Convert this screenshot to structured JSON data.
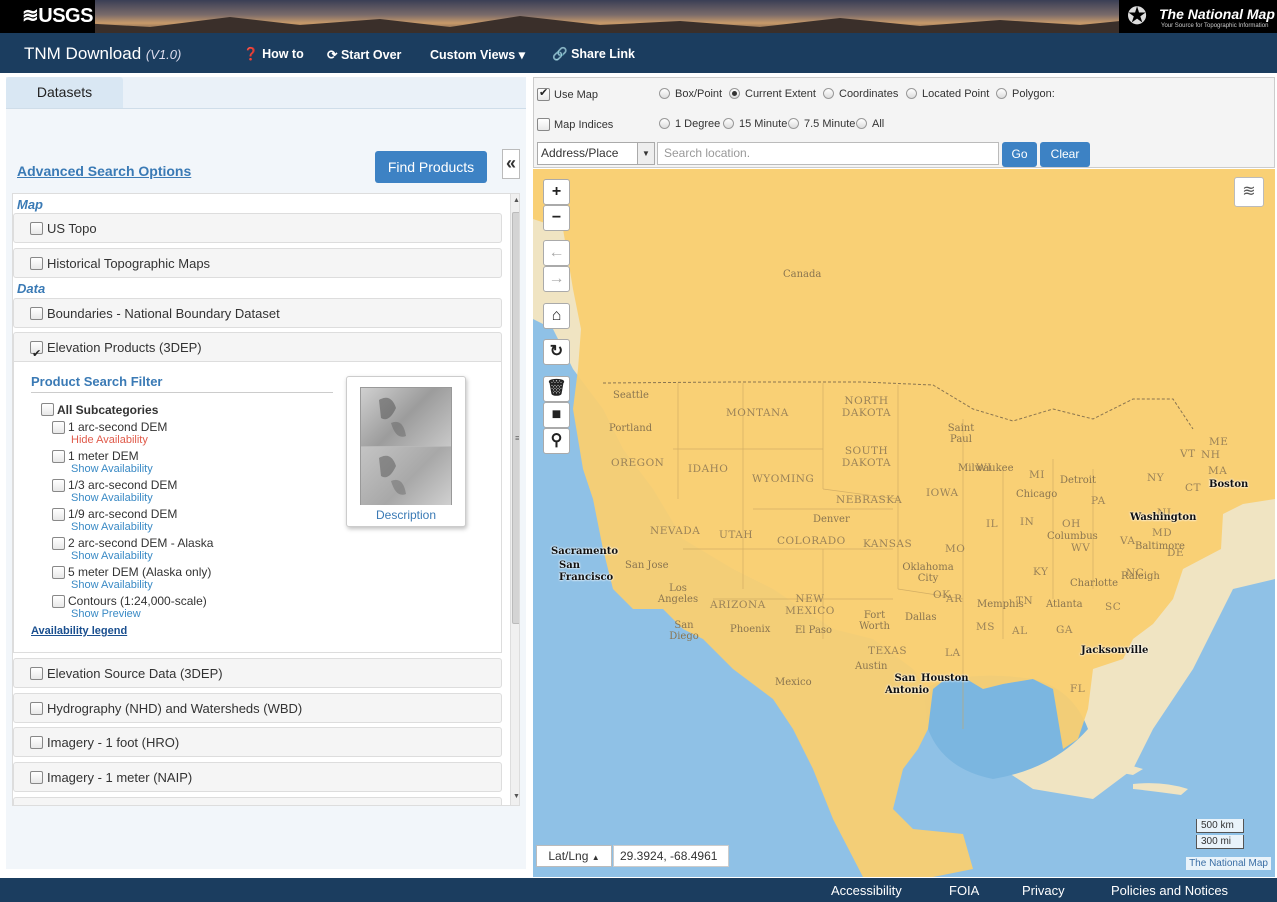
{
  "header": {
    "usgs_logo": "≋USGS",
    "tnm_logo_title": "The National Map",
    "tnm_logo_subtitle": "Your Source for Topographic Information"
  },
  "nav": {
    "app_title": "TNM Download",
    "version": "(V1.0)",
    "how_to": "How to",
    "start_over": "Start Over",
    "custom_views": "Custom Views",
    "share_link": "Share Link"
  },
  "left": {
    "tab": "Datasets",
    "advanced_search": "Advanced Search Options",
    "find_products": "Find Products",
    "collapse": "«",
    "section_map": "Map",
    "section_data": "Data",
    "items": {
      "us_topo": "US Topo",
      "historical": "Historical Topographic Maps",
      "boundaries": "Boundaries - National Boundary Dataset",
      "elevation": "Elevation Products (3DEP)",
      "elev_source": "Elevation Source Data (3DEP)",
      "hydro": "Hydrography (NHD) and Watersheds (WBD)",
      "imagery_hro": "Imagery - 1 foot (HRO)",
      "imagery_naip": "Imagery - 1 meter (NAIP)"
    },
    "filter": {
      "title": "Product Search Filter",
      "all_subcategories": "All Subcategories",
      "subitems": [
        {
          "label": "1 arc-second DEM",
          "action": "Hide Availability"
        },
        {
          "label": "1 meter DEM",
          "action": "Show Availability"
        },
        {
          "label": "1/3 arc-second DEM",
          "action": "Show Availability"
        },
        {
          "label": "1/9 arc-second DEM",
          "action": "Show Availability"
        },
        {
          "label": "2 arc-second DEM - Alaska",
          "action": "Show Availability"
        },
        {
          "label": "5 meter DEM (Alaska only)",
          "action": "Show Availability"
        },
        {
          "label": "Contours (1:24,000-scale)",
          "action": "Show Preview"
        }
      ],
      "availability_legend": "Availability legend",
      "description": "Description"
    }
  },
  "right": {
    "use_map": "Use Map",
    "map_indices": "Map Indices",
    "extent_options": [
      "Box/Point",
      "Current Extent",
      "Coordinates",
      "Located Point",
      "Polygon:"
    ],
    "index_options": [
      "1 Degree",
      "15 Minute",
      "7.5 Minute",
      "All"
    ],
    "address_select": "Address/Place",
    "search_placeholder": "Search location.",
    "go": "Go",
    "clear": "Clear"
  },
  "map": {
    "labels": {
      "canada": "Canada",
      "mexico": "Mexico",
      "states": [
        "MONTANA",
        "NORTH DAKOTA",
        "SOUTH DAKOTA",
        "OREGON",
        "IDAHO",
        "WYOMING",
        "NEBRASKA",
        "IOWA",
        "NEVADA",
        "UTAH",
        "COLORADO",
        "KANSAS",
        "ARIZONA",
        "NEW MEXICO",
        "TEXAS",
        "MO",
        "IL",
        "IN",
        "OH",
        "KY",
        "TN",
        "AR",
        "MS",
        "AL",
        "GA",
        "SC",
        "NC",
        "VA",
        "WV",
        "PA",
        "NY",
        "MI",
        "FL",
        "LA",
        "OK",
        "MA",
        "ME",
        "VT",
        "NH",
        "CT",
        "NJ",
        "MD",
        "DE",
        "WI"
      ],
      "cities": [
        "Seattle",
        "Portland",
        "Saint Paul",
        "Milwaukee",
        "Chicago",
        "Detroit",
        "Denver",
        "Columbus",
        "Washington",
        "Baltimore",
        "Raleigh",
        "Charlotte",
        "Atlanta",
        "Memphis",
        "Dallas",
        "Fort Worth",
        "Oklahoma City",
        "Austin",
        "El Paso",
        "Phoenix",
        "Los Angeles",
        "San Diego",
        "San Jose",
        "Sacramento",
        "San Francisco",
        "Houston",
        "San Antonio",
        "Jacksonville",
        "Boston"
      ]
    },
    "latlng_label": "Lat/Lng",
    "coordinates": "29.3924, -68.4961",
    "scale_km": "500 km",
    "scale_mi": "300 mi",
    "attribution": "The National Map",
    "controls": {
      "zoom_in": "+",
      "zoom_out": "−"
    }
  },
  "footer": {
    "accessibility": "Accessibility",
    "foia": "FOIA",
    "privacy": "Privacy",
    "policies": "Policies and Notices"
  }
}
